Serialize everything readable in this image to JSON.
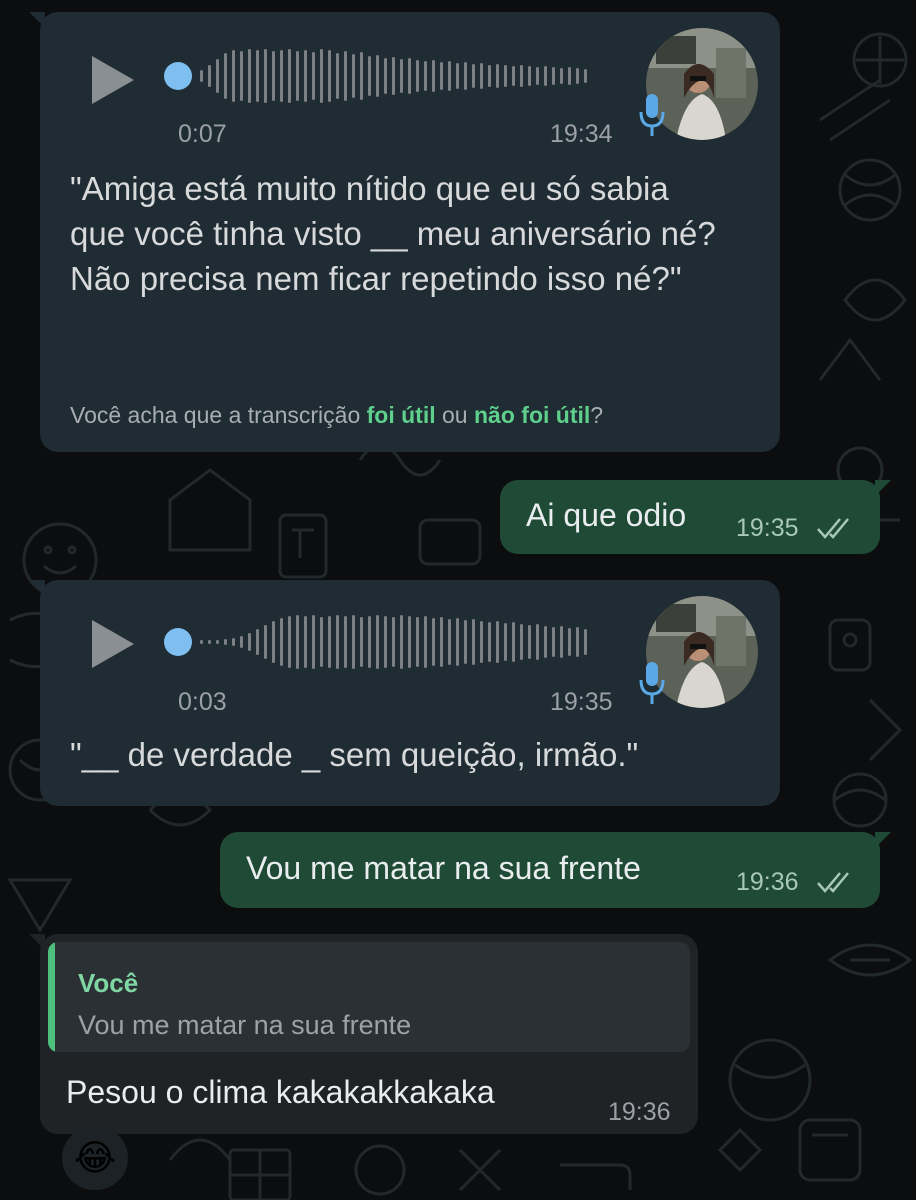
{
  "voice_messages": [
    {
      "duration": "0:07",
      "time": "19:34",
      "transcript": "\"Amiga está muito nítido que eu só sabia que você tinha visto __ meu aniversário né? Não precisa nem ficar repetindo isso né?\"",
      "feedback": {
        "prefix": "Você acha que a transcrição ",
        "option_useful": "foi útil",
        "connector": " ou ",
        "option_not_useful": "não foi útil",
        "suffix": "?"
      }
    },
    {
      "duration": "0:03",
      "time": "19:35",
      "transcript": "\"__ de verdade _ sem queição, irmão.\""
    }
  ],
  "sent_messages": [
    {
      "text": "Ai que odio",
      "time": "19:35",
      "status": "read"
    },
    {
      "text": "Vou me matar na sua frente",
      "time": "19:36",
      "status": "read"
    }
  ],
  "reply_message": {
    "quote_author": "Você",
    "quote_text": "Vou me matar na sua frente",
    "text": "Pesou o clima kakakakkakaka",
    "time": "19:36",
    "reaction": "😂"
  },
  "colors": {
    "incoming_bubble": "#202c33",
    "outgoing_bubble": "#1f4a35",
    "accent_green": "#5fcf8c",
    "voice_dot_blue": "#7fbff0"
  },
  "icons": [
    "play-icon",
    "mic-icon",
    "double-check-icon",
    "avatar-photo"
  ]
}
